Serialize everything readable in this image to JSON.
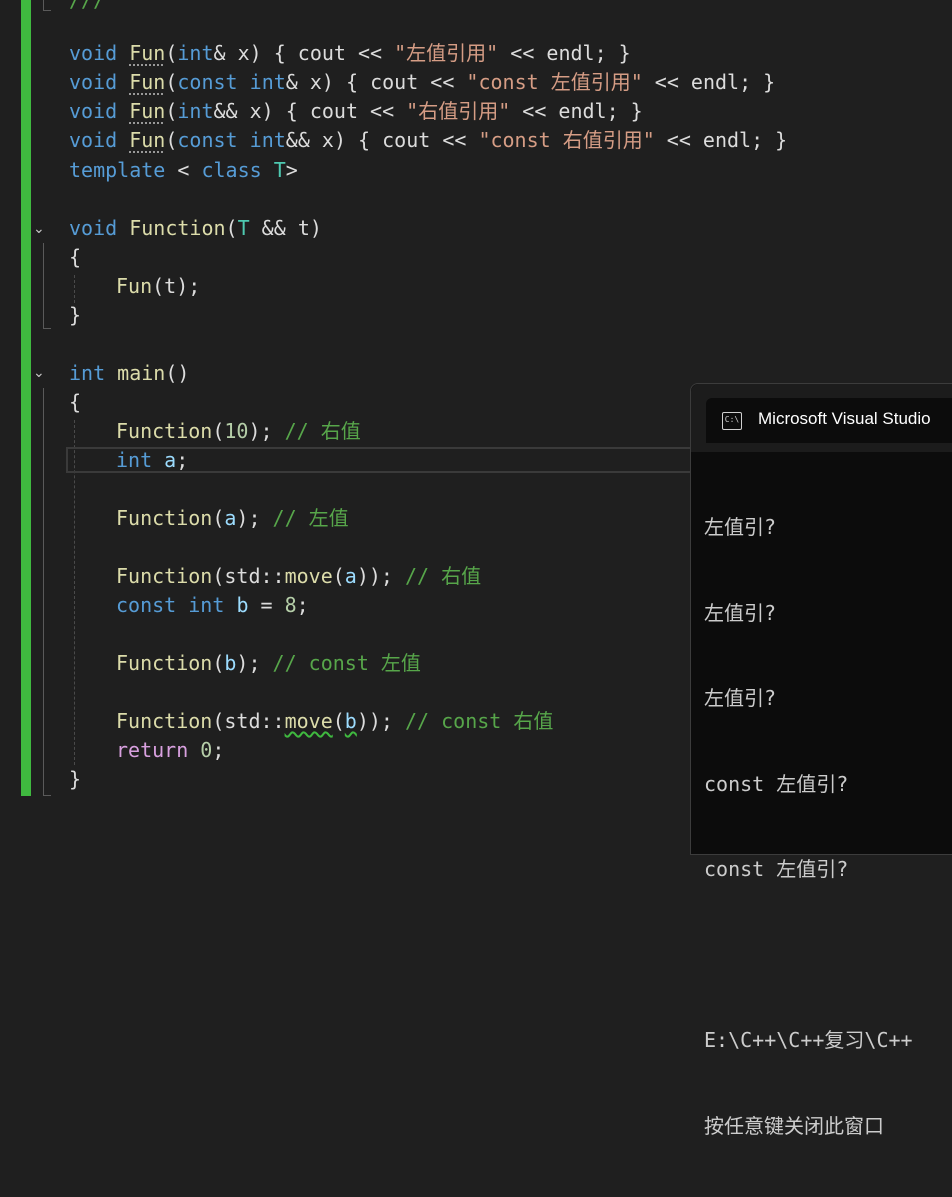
{
  "editor": {
    "partial_top": "///",
    "lines": {
      "l1": {
        "kw": "void",
        "fn": "Fun",
        "p1": "(",
        "ty": "int",
        "p2": "& x) { cout << ",
        "str": "\"左值引用\"",
        "p3": " << endl; }"
      },
      "l2": {
        "kw": "void",
        "fn": "Fun",
        "p1": "(",
        "kw2": "const",
        "ty": "int",
        "p2": "& x) { cout << ",
        "str": "\"const 左值引用\"",
        "p3": " << endl; }"
      },
      "l3": {
        "kw": "void",
        "fn": "Fun",
        "p1": "(",
        "ty": "int",
        "p2": "&& x) { cout << ",
        "str": "\"右值引用\"",
        "p3": " << endl; }"
      },
      "l4": {
        "kw": "void",
        "fn": "Fun",
        "p1": "(",
        "kw2": "const",
        "ty": "int",
        "p2": "&& x) { cout << ",
        "str": "\"const 右值引用\"",
        "p3": " << endl; }"
      },
      "l5": {
        "kw": "template",
        "p1": " < ",
        "kw2": "class",
        "ty": "T",
        "p2": ">"
      },
      "l6": {
        "kw": "void",
        "fn": "Function",
        "p1": "(",
        "ty": "T",
        "p2": " && ",
        "pm": "t",
        "p3": ")"
      },
      "l7": "{",
      "l8": {
        "fn": "Fun",
        "p1": "(",
        "pm": "t",
        "p2": ");"
      },
      "l9": "}",
      "l10": {
        "kw": "int",
        "fn": "main",
        "p1": "()"
      },
      "l11": "{",
      "l12": {
        "fn": "Function",
        "p1": "(",
        "nm": "10",
        "p2": "); ",
        "cm": "// 右值"
      },
      "l13": {
        "kw": "int",
        "vr": "a",
        "p1": ";"
      },
      "l14": {
        "fn": "Function",
        "p1": "(",
        "vr": "a",
        "p2": "); ",
        "cm": "// 左值"
      },
      "l15": {
        "fn": "Function",
        "p1": "(std::",
        "fn2": "move",
        "p2": "(",
        "vr": "a",
        "p3": ")); ",
        "cm": "// 右值"
      },
      "l16": {
        "kw": "const",
        "kw_b": "int",
        "vr": "b",
        "p1": " = ",
        "nm": "8",
        "p2": ";"
      },
      "l17": {
        "fn": "Function",
        "p1": "(",
        "vr": "b",
        "p2": "); ",
        "cm": "// const 左值"
      },
      "l18": {
        "fn": "Function",
        "p1": "(std::",
        "fn2": "move",
        "p2": "(",
        "vr": "b",
        "p3": ")); ",
        "cm": "// const 右值"
      },
      "l19": {
        "kw": "return",
        "nm": "0",
        "p1": ";"
      },
      "l20": "}"
    }
  },
  "console": {
    "title": "Microsoft Visual Studio",
    "icon": "console-icon",
    "output": [
      "左值引?",
      "左值引?",
      "左值引?",
      "const 左值引?",
      "const 左值引?",
      "",
      "E:\\C++\\C++复习\\C++",
      "按任意键关闭此窗口"
    ]
  },
  "colors": {
    "change_bar": "#3fb93f",
    "background": "#1f1f1f",
    "keyword": "#569cd6",
    "function": "#dcdcaa",
    "string": "#d69d85",
    "comment": "#57a64a"
  }
}
